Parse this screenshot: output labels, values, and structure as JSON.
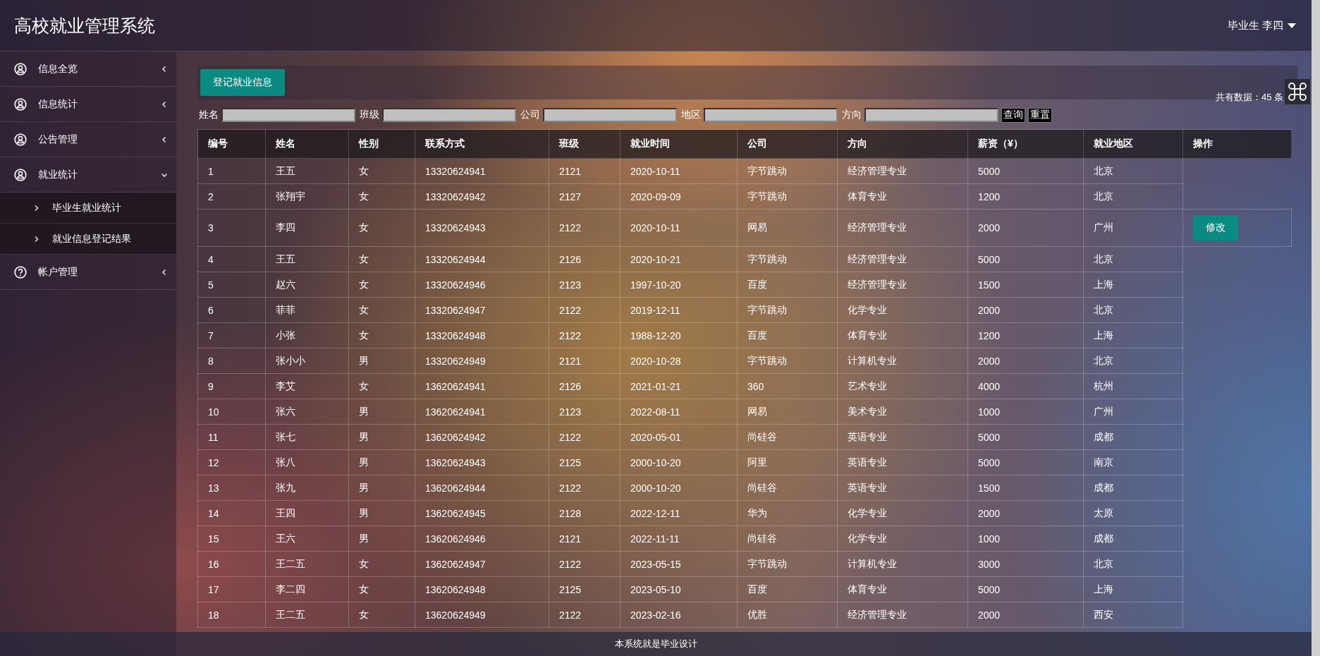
{
  "app_title": "高校就业管理系统",
  "user_menu": {
    "label": "毕业生 李四"
  },
  "sidebar": {
    "items": [
      {
        "label": "信息全览",
        "kind": "user",
        "expanded": false
      },
      {
        "label": "信息统计",
        "kind": "user",
        "expanded": false
      },
      {
        "label": "公告管理",
        "kind": "user",
        "expanded": false
      },
      {
        "label": "就业统计",
        "kind": "user",
        "expanded": true,
        "children": [
          {
            "label": "毕业生就业统计"
          },
          {
            "label": "就业信息登记结果"
          }
        ]
      },
      {
        "label": "帐户管理",
        "kind": "help",
        "expanded": false
      }
    ]
  },
  "toolbar": {
    "add_button": "登记就业信息",
    "total": "共有数据：45 条"
  },
  "filters": {
    "fields": [
      {
        "label": "姓名"
      },
      {
        "label": "班级"
      },
      {
        "label": "公司"
      },
      {
        "label": "地区"
      },
      {
        "label": "方向"
      }
    ],
    "buttons": [
      "查询",
      "重置"
    ]
  },
  "table": {
    "columns": [
      "编号",
      "姓名",
      "性别",
      "联系方式",
      "班级",
      "就业时间",
      "公司",
      "方向",
      "薪资（¥）",
      "就业地区",
      "操作"
    ],
    "rows": [
      {
        "cells": [
          "1",
          "王五",
          "女",
          "13320624941",
          "2121",
          "2020-10-11",
          "字节跳动",
          "经济管理专业",
          "5000",
          "北京"
        ]
      },
      {
        "cells": [
          "2",
          "张翔宇",
          "女",
          "13320624942",
          "2127",
          "2020-09-09",
          "字节跳动",
          "体育专业",
          "1200",
          "北京"
        ]
      },
      {
        "cells": [
          "3",
          "李四",
          "女",
          "13320624943",
          "2122",
          "2020-10-11",
          "网易",
          "经济管理专业",
          "2000",
          "广州"
        ],
        "action": "修改"
      },
      {
        "cells": [
          "4",
          "王五",
          "女",
          "13320624944",
          "2126",
          "2020-10-21",
          "字节跳动",
          "经济管理专业",
          "5000",
          "北京"
        ]
      },
      {
        "cells": [
          "5",
          "赵六",
          "女",
          "13320624946",
          "2123",
          "1997-10-20",
          "百度",
          "经济管理专业",
          "1500",
          "上海"
        ]
      },
      {
        "cells": [
          "6",
          "菲菲",
          "女",
          "13320624947",
          "2122",
          "2019-12-11",
          "字节跳动",
          "化学专业",
          "2000",
          "北京"
        ]
      },
      {
        "cells": [
          "7",
          "小张",
          "女",
          "13320624948",
          "2122",
          "1988-12-20",
          "百度",
          "体育专业",
          "1200",
          "上海"
        ]
      },
      {
        "cells": [
          "8",
          "张小小",
          "男",
          "13320624949",
          "2121",
          "2020-10-28",
          "字节跳动",
          "计算机专业",
          "2000",
          "北京"
        ]
      },
      {
        "cells": [
          "9",
          "李艾",
          "女",
          "13620624941",
          "2126",
          "2021-01-21",
          "360",
          "艺术专业",
          "4000",
          "杭州"
        ]
      },
      {
        "cells": [
          "10",
          "张六",
          "男",
          "13620624941",
          "2123",
          "2022-08-11",
          "网易",
          "美术专业",
          "1000",
          "广州"
        ]
      },
      {
        "cells": [
          "11",
          "张七",
          "男",
          "13620624942",
          "2122",
          "2020-05-01",
          "尚硅谷",
          "英语专业",
          "5000",
          "成都"
        ]
      },
      {
        "cells": [
          "12",
          "张八",
          "男",
          "13620624943",
          "2125",
          "2000-10-20",
          "阿里",
          "英语专业",
          "5000",
          "南京"
        ]
      },
      {
        "cells": [
          "13",
          "张九",
          "男",
          "13620624944",
          "2122",
          "2000-10-20",
          "尚硅谷",
          "英语专业",
          "1500",
          "成都"
        ]
      },
      {
        "cells": [
          "14",
          "王四",
          "男",
          "13620624945",
          "2128",
          "2022-12-11",
          "华为",
          "化学专业",
          "2000",
          "太原"
        ]
      },
      {
        "cells": [
          "15",
          "王六",
          "男",
          "13620624946",
          "2121",
          "2022-11-11",
          "尚硅谷",
          "化学专业",
          "1000",
          "成都"
        ]
      },
      {
        "cells": [
          "16",
          "王二五",
          "女",
          "13620624947",
          "2122",
          "2023-05-15",
          "字节跳动",
          "计算机专业",
          "3000",
          "北京"
        ]
      },
      {
        "cells": [
          "17",
          "李二四",
          "女",
          "13620624948",
          "2125",
          "2023-05-10",
          "百度",
          "体育专业",
          "5000",
          "上海"
        ]
      },
      {
        "cells": [
          "18",
          "王二五",
          "女",
          "13620624949",
          "2122",
          "2023-02-16",
          "优胜",
          "经济管理专业",
          "2000",
          "西安"
        ]
      }
    ]
  },
  "footer": "本系统就是毕业设计"
}
